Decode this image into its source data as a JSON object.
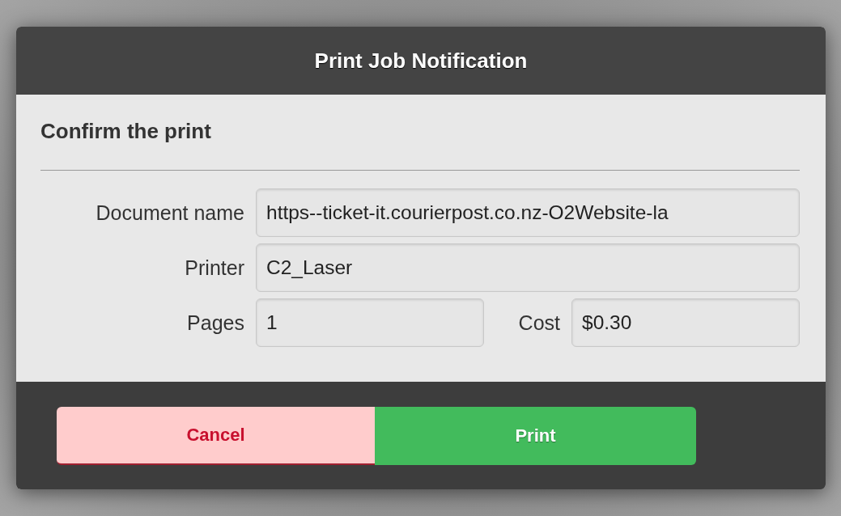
{
  "dialog": {
    "title": "Print Job Notification",
    "heading": "Confirm the print",
    "fields": [
      {
        "label": "Document name",
        "value": "https--ticket-it.courierpost.co.nz-O2Website-la"
      },
      {
        "label": "Printer",
        "value": "C2_Laser"
      }
    ],
    "pair": [
      {
        "label": "Pages",
        "value": "1"
      },
      {
        "label": "Cost",
        "value": "$0.30"
      }
    ],
    "buttons": [
      {
        "label": "Cancel",
        "kind": "cancel"
      },
      {
        "label": "Print",
        "kind": "confirm"
      }
    ]
  }
}
